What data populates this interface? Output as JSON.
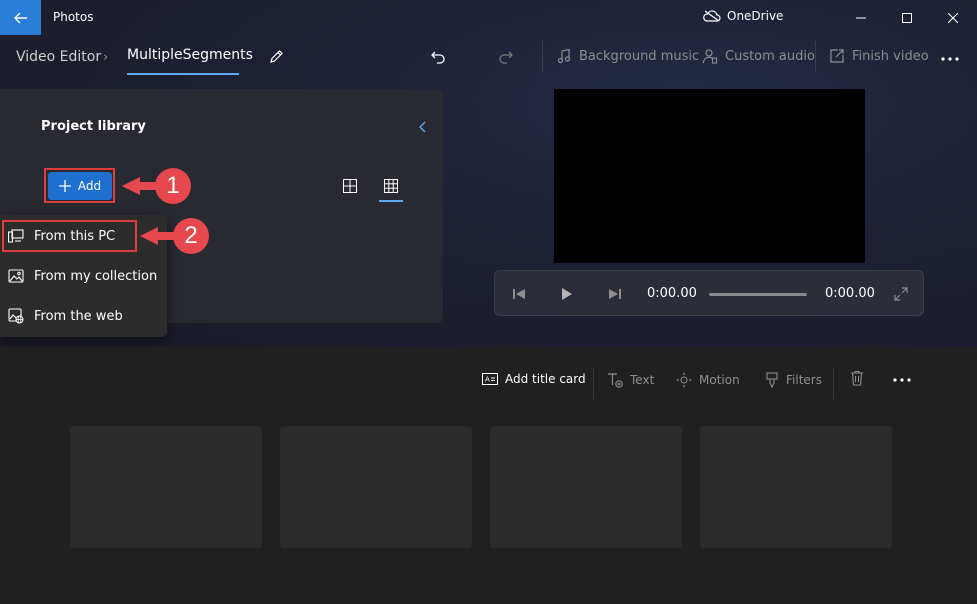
{
  "titlebar": {
    "app_title": "Photos",
    "onedrive_label": "OneDrive"
  },
  "header": {
    "breadcrumb_root": "Video Editor",
    "breadcrumb_current": "MultipleSegments",
    "tools": {
      "background_music": "Background music",
      "custom_audio": "Custom audio",
      "finish_video": "Finish video"
    }
  },
  "library": {
    "title": "Project library",
    "add_label": "Add"
  },
  "dropdown": {
    "items": [
      {
        "label": "From this PC",
        "icon": "pc-icon"
      },
      {
        "label": "From my collection",
        "icon": "image-icon"
      },
      {
        "label": "From the web",
        "icon": "web-image-icon"
      }
    ]
  },
  "callouts": [
    "1",
    "2"
  ],
  "player": {
    "current_time": "0:00.00",
    "total_time": "0:00.00"
  },
  "storyboard": {
    "tools": {
      "add_title_card": "Add title card",
      "text": "Text",
      "motion": "Motion",
      "filters": "Filters"
    },
    "slot_count": 4
  },
  "colors": {
    "accent": "#1f6fd0",
    "callout": "#e5484d",
    "highlight": "#e03d3d"
  }
}
